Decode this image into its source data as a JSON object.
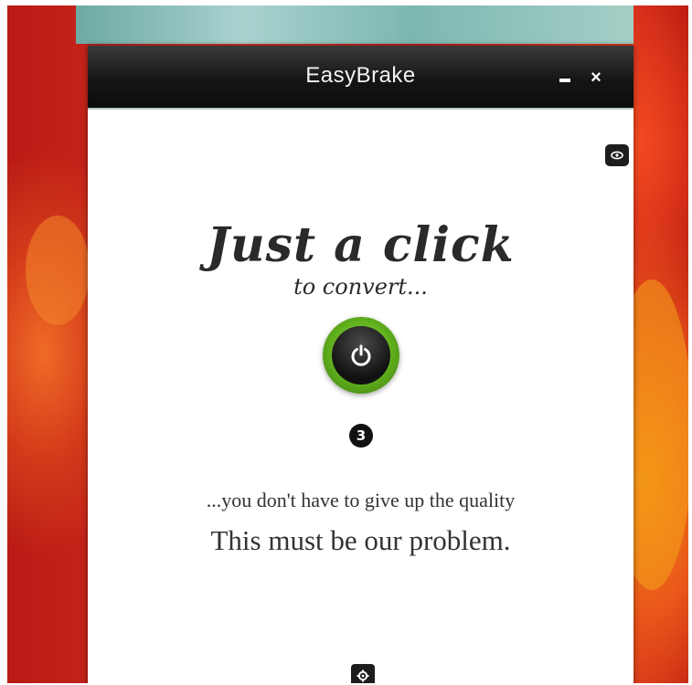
{
  "window": {
    "title": "EasyBrake",
    "minimize_icon": "minimize-icon",
    "close_label": "×"
  },
  "main": {
    "headline": "Just a click",
    "subline": "to convert...",
    "power_icon": "power-icon",
    "queue_count": "3",
    "tagline": "...you don't have to give up the quality",
    "slogan": "This must be our problem."
  },
  "tabs": {
    "side_icon": "eye-icon",
    "bottom_icon": "gear-icon"
  },
  "colors": {
    "titlebar": "#151515",
    "accent_green": "#6fbf24",
    "background_flower": "#d93423"
  }
}
